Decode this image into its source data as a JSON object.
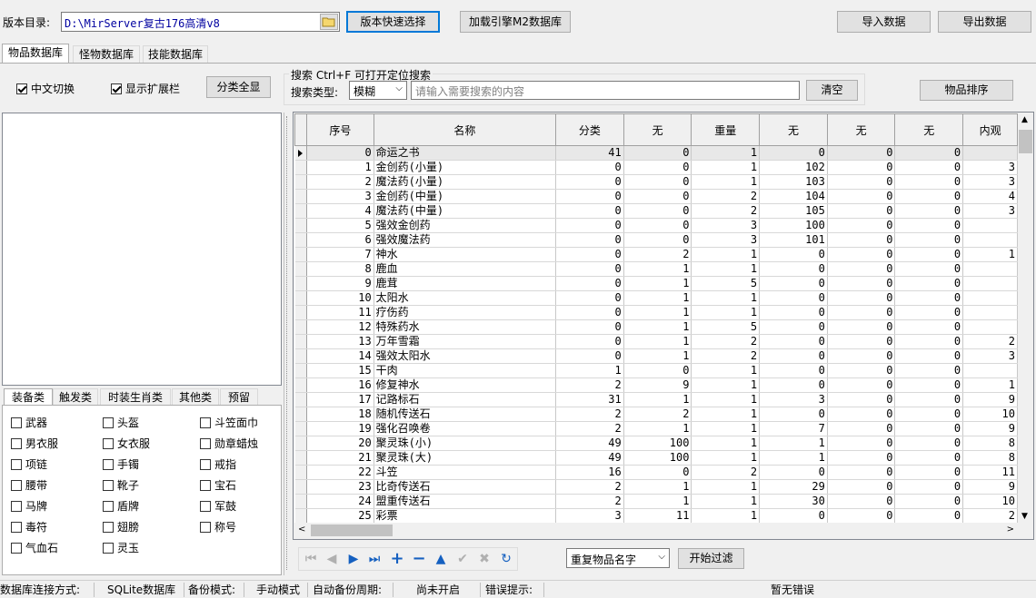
{
  "toolbar": {
    "version_label": "版本目录:",
    "version_path": "D:\\MirServer复古176高清v8",
    "quick_select": "版本快速选择",
    "load_db": "加载引擎M2数据库",
    "import": "导入数据",
    "export": "导出数据"
  },
  "tabs": [
    "物品数据库",
    "怪物数据库",
    "技能数据库"
  ],
  "options": {
    "chinese": "中文切换",
    "show_ext": "显示扩展栏",
    "show_all": "分类全显"
  },
  "search": {
    "title": "搜索  Ctrl+F 可打开定位搜索",
    "type_label": "搜索类型:",
    "type_value": "模糊",
    "placeholder": "请输入需要搜索的内容",
    "clear": "清空",
    "sort": "物品排序"
  },
  "category_tabs": [
    "装备类",
    "触发类",
    "时装生肖类",
    "其他类",
    "预留"
  ],
  "checkboxes": [
    [
      "武器",
      "头盔",
      "斗笠面巾"
    ],
    [
      "男衣服",
      "女衣服",
      "勋章蜡烛"
    ],
    [
      "项链",
      "手镯",
      "戒指"
    ],
    [
      "腰带",
      "靴子",
      "宝石"
    ],
    [
      "马牌",
      "盾牌",
      "军鼓"
    ],
    [
      "毒符",
      "翅膀",
      "称号"
    ],
    [
      "气血石",
      "灵玉",
      ""
    ]
  ],
  "grid": {
    "headers": [
      "序号",
      "名称",
      "分类",
      "无",
      "重量",
      "无",
      "无",
      "无",
      "内观"
    ],
    "rows": [
      [
        "0",
        "命运之书",
        "41",
        "0",
        "1",
        "0",
        "0",
        "0",
        ""
      ],
      [
        "1",
        "金创药(小量)",
        "0",
        "0",
        "1",
        "102",
        "0",
        "0",
        "3"
      ],
      [
        "2",
        "魔法药(小量)",
        "0",
        "0",
        "1",
        "103",
        "0",
        "0",
        "3"
      ],
      [
        "3",
        "金创药(中量)",
        "0",
        "0",
        "2",
        "104",
        "0",
        "0",
        "4"
      ],
      [
        "4",
        "魔法药(中量)",
        "0",
        "0",
        "2",
        "105",
        "0",
        "0",
        "3"
      ],
      [
        "5",
        "强效金创药",
        "0",
        "0",
        "3",
        "100",
        "0",
        "0",
        ""
      ],
      [
        "6",
        "强效魔法药",
        "0",
        "0",
        "3",
        "101",
        "0",
        "0",
        ""
      ],
      [
        "7",
        "神水",
        "0",
        "2",
        "1",
        "0",
        "0",
        "0",
        "1"
      ],
      [
        "8",
        "鹿血",
        "0",
        "1",
        "1",
        "0",
        "0",
        "0",
        ""
      ],
      [
        "9",
        "鹿茸",
        "0",
        "1",
        "5",
        "0",
        "0",
        "0",
        ""
      ],
      [
        "10",
        "太阳水",
        "0",
        "1",
        "1",
        "0",
        "0",
        "0",
        ""
      ],
      [
        "11",
        "疗伤药",
        "0",
        "1",
        "1",
        "0",
        "0",
        "0",
        ""
      ],
      [
        "12",
        "特殊药水",
        "0",
        "1",
        "5",
        "0",
        "0",
        "0",
        ""
      ],
      [
        "13",
        "万年雪霜",
        "0",
        "1",
        "2",
        "0",
        "0",
        "0",
        "2"
      ],
      [
        "14",
        "强效太阳水",
        "0",
        "1",
        "2",
        "0",
        "0",
        "0",
        "3"
      ],
      [
        "15",
        "干肉",
        "1",
        "0",
        "1",
        "0",
        "0",
        "0",
        ""
      ],
      [
        "16",
        "修复神水",
        "2",
        "9",
        "1",
        "0",
        "0",
        "0",
        "1"
      ],
      [
        "17",
        "记路标石",
        "31",
        "1",
        "1",
        "3",
        "0",
        "0",
        "9"
      ],
      [
        "18",
        "随机传送石",
        "2",
        "2",
        "1",
        "0",
        "0",
        "0",
        "10"
      ],
      [
        "19",
        "强化召唤卷",
        "2",
        "1",
        "1",
        "7",
        "0",
        "0",
        "9"
      ],
      [
        "20",
        "聚灵珠(小)",
        "49",
        "100",
        "1",
        "1",
        "0",
        "0",
        "8"
      ],
      [
        "21",
        "聚灵珠(大)",
        "49",
        "100",
        "1",
        "1",
        "0",
        "0",
        "8"
      ],
      [
        "22",
        "斗笠",
        "16",
        "0",
        "2",
        "0",
        "0",
        "0",
        "11"
      ],
      [
        "23",
        "比奇传送石",
        "2",
        "1",
        "1",
        "29",
        "0",
        "0",
        "9"
      ],
      [
        "24",
        "盟重传送石",
        "2",
        "1",
        "1",
        "30",
        "0",
        "0",
        "10"
      ],
      [
        "25",
        "彩票",
        "3",
        "11",
        "1",
        "0",
        "0",
        "0",
        "2"
      ]
    ]
  },
  "filter": {
    "value": "重复物品名字",
    "start": "开始过滤"
  },
  "status": {
    "conn_label": "数据库连接方式:",
    "conn_value": "SQLite数据库",
    "backup_label": "备份模式:",
    "backup_value": "手动模式",
    "auto_label": "自动备份周期:",
    "auto_value": "尚未开启",
    "err_label": "错误提示:",
    "err_value": "暂无错误"
  }
}
